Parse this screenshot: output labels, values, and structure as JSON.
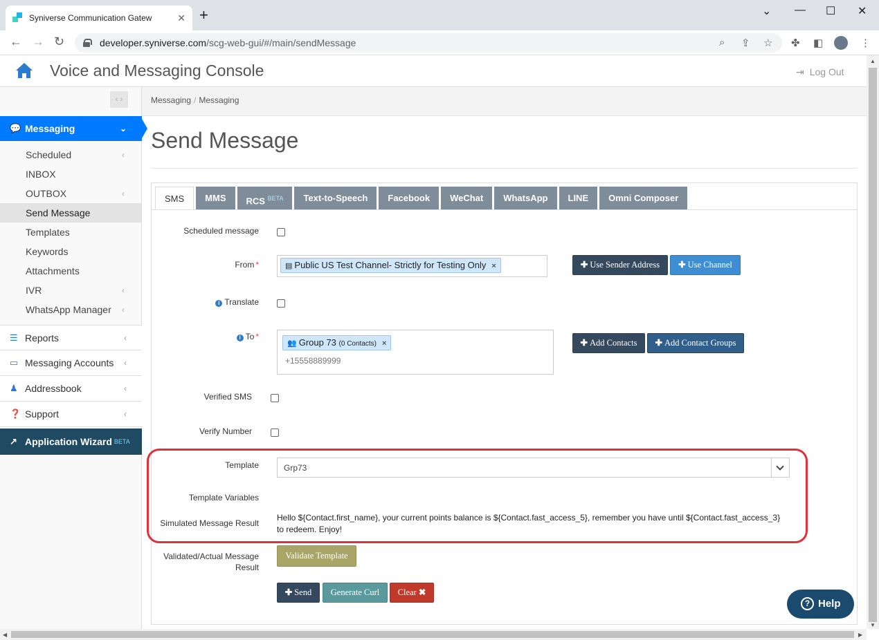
{
  "browser": {
    "tab_title": "Syniverse Communication Gatew",
    "url_host": "developer.syniverse.com",
    "url_path": "/scg-web-gui/#/main/sendMessage"
  },
  "header": {
    "app_title": "Voice and Messaging Console",
    "logout_label": "Log Out"
  },
  "sidebar": {
    "messaging": "Messaging",
    "sub_items": [
      "Scheduled",
      "INBOX",
      "OUTBOX",
      "Send Message",
      "Templates",
      "Keywords",
      "Attachments",
      "IVR",
      "WhatsApp Manager"
    ],
    "reports": "Reports",
    "messaging_accounts": "Messaging Accounts",
    "addressbook": "Addressbook",
    "support": "Support",
    "wizard": "Application Wizard",
    "wizard_beta": "BETA"
  },
  "breadcrumb": [
    "Messaging",
    "Messaging"
  ],
  "page_title": "Send Message",
  "tabs": [
    "SMS",
    "MMS",
    "RCS",
    "Text-to-Speech",
    "Facebook",
    "WeChat",
    "WhatsApp",
    "LINE",
    "Omni Composer"
  ],
  "rcs_beta": "BETA",
  "form": {
    "scheduled_label": "Scheduled message",
    "from_label": "From",
    "required_mark": "*",
    "from_chip": "Public US Test Channel- Strictly for Testing Only",
    "chip_remove": "×",
    "use_sender_btn": "Use Sender Address",
    "use_channel_btn": "Use Channel",
    "translate_label": "Translate",
    "to_label": "To",
    "to_chip": "Group 73",
    "to_chip_count": "(0 Contacts)",
    "to_placeholder": "+15558889999",
    "add_contacts_btn": "Add Contacts",
    "add_groups_btn": "Add Contact Groups",
    "verified_sms_label": "Verified SMS",
    "verify_number_label": "Verify Number",
    "template_label": "Template",
    "template_value": "Grp73",
    "template_vars_label": "Template Variables",
    "simulated_label": "Simulated Message Result",
    "simulated_text": "Hello ${Contact.first_name}, your current points balance is ${Contact.fast_access_5}, remember you have until ${Contact.fast_access_3} to redeem. Enjoy!",
    "validated_label_1": "Validated/Actual Message",
    "validated_label_2": "Result",
    "validate_btn": "Validate Template",
    "send_btn": "Send",
    "curl_btn": "Generate Curl",
    "clear_btn": "Clear"
  },
  "help_label": "Help",
  "colors": {
    "primary": "#007bff",
    "highlight": "#e0303a",
    "sidebar_wizard": "#204a62"
  }
}
